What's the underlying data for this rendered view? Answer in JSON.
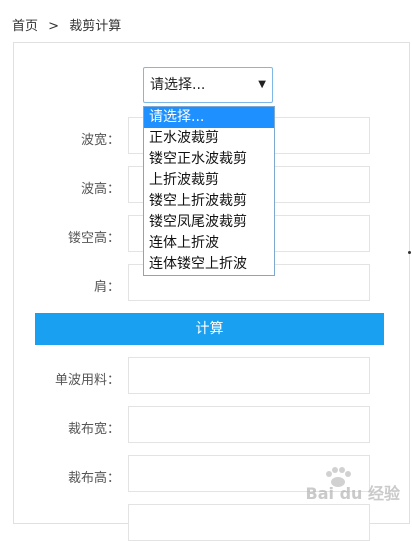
{
  "breadcrumb": {
    "home": "首页",
    "sep": ">",
    "current": "裁剪计算"
  },
  "select": {
    "value": "请选择...",
    "options": [
      "请选择...",
      "正水波裁剪",
      "镂空正水波裁剪",
      "上折波裁剪",
      "镂空上折波裁剪",
      "镂空凤尾波裁剪",
      "连体上折波",
      "连体镂空上折波"
    ]
  },
  "inputs": {
    "wave_width": "波宽：",
    "wave_height": "波高：",
    "hollow_height": "镂空高：",
    "shoulder": "肩："
  },
  "calc_button": "计算",
  "outputs": {
    "single_wave_material": "单波用料：",
    "cloth_width": "裁布宽：",
    "cloth_height": "裁布高："
  },
  "watermark": {
    "text": "Bai du 经验"
  }
}
